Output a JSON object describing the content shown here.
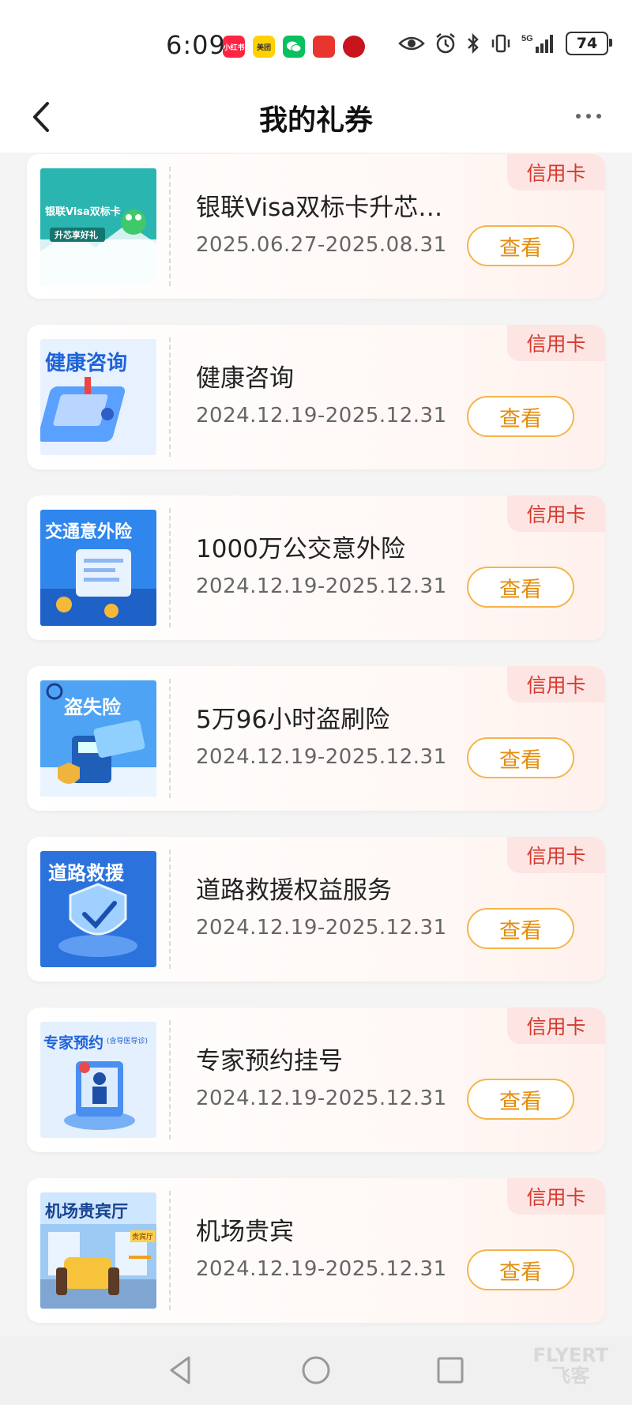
{
  "status_bar": {
    "time": "6:09",
    "apps": [
      {
        "name": "xiaohongshu-icon",
        "color": "#ff2442",
        "text": "小红书"
      },
      {
        "name": "meituan-icon",
        "color": "#ffd100",
        "text": "美团"
      },
      {
        "name": "wechat-icon",
        "color": "#07c160",
        "text": ""
      },
      {
        "name": "app-red-icon",
        "color": "#e8352e",
        "text": ""
      },
      {
        "name": "app-darkred-icon",
        "color": "#c8151d",
        "text": ""
      }
    ],
    "battery": "74",
    "network": "5G"
  },
  "nav": {
    "title": "我的礼券"
  },
  "coupons": [
    {
      "title": "银联Visa双标卡升芯…",
      "date": "2025.06.27-2025.08.31",
      "badge": "信用卡",
      "button": "查看",
      "thumb_text": "银联Visa双标卡",
      "thumb_sub": "升芯享好礼",
      "thumb_color": "#1db0a6"
    },
    {
      "title": "健康咨询",
      "date": "2024.12.19-2025.12.31",
      "badge": "信用卡",
      "button": "查看",
      "thumb_text": "健康咨询",
      "thumb_sub": "",
      "thumb_color": "#3f8ef0"
    },
    {
      "title": "1000万公交意外险",
      "date": "2024.12.19-2025.12.31",
      "badge": "信用卡",
      "button": "查看",
      "thumb_text": "交通意外险",
      "thumb_sub": "",
      "thumb_color": "#1f79e8"
    },
    {
      "title": "5万96小时盗刷险",
      "date": "2024.12.19-2025.12.31",
      "badge": "信用卡",
      "button": "查看",
      "thumb_text": "盗失险",
      "thumb_sub": "",
      "thumb_color": "#3a94f0"
    },
    {
      "title": "道路救援权益服务",
      "date": "2024.12.19-2025.12.31",
      "badge": "信用卡",
      "button": "查看",
      "thumb_text": "道路救援",
      "thumb_sub": "",
      "thumb_color": "#2c6fdc"
    },
    {
      "title": "专家预约挂号",
      "date": "2024.12.19-2025.12.31",
      "badge": "信用卡",
      "button": "查看",
      "thumb_text": "专家预约",
      "thumb_sub": "(含导医导诊)",
      "thumb_color": "#3f8ef0"
    },
    {
      "title": "机场贵宾",
      "date": "2024.12.19-2025.12.31",
      "badge": "信用卡",
      "button": "查看",
      "thumb_text": "机场贵宾厅",
      "thumb_sub": "贵宾厅",
      "thumb_color": "#2f86e6"
    }
  ],
  "bottom_nav": {
    "watermark_line1": "FLYERT",
    "watermark_line2": "飞客"
  }
}
